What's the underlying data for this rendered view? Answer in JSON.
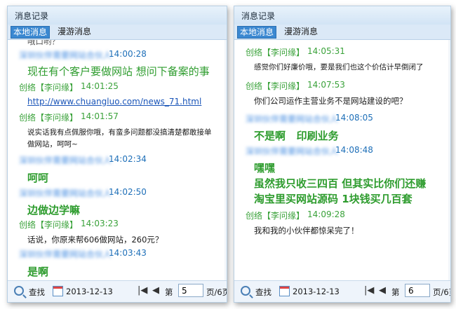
{
  "left": {
    "title": "消息记录",
    "tabs": [
      "本地消息",
      "漫游消息"
    ],
    "partial_top": "哦口哟？",
    "messages": [
      {
        "name": "深圳伙伴需要网站合伙人",
        "time": "14:00:28",
        "text": "现在有个客户要做网站 想问下备案的事",
        "style": "big"
      },
      {
        "name": "创络【李问缘】",
        "time": "14:01:25",
        "text": "http://www.chuangluo.com/news_71.html",
        "style": "link"
      },
      {
        "name": "创络【李问缘】",
        "time": "14:01:57",
        "text": "说实话我有点佩服你哦，有蛮多问题都没搞清楚都敢接单",
        "text2": "做网站，呵呵~",
        "style": "normal"
      },
      {
        "name": "深圳伙伴需要网站合伙人",
        "time": "14:02:34",
        "text": "呵呵",
        "style": "big"
      },
      {
        "name": "深圳伙伴需要网站合伙人",
        "time": "14:02:50",
        "text": "边做边学嘛",
        "style": "big"
      },
      {
        "name": "创络【李问缘】",
        "time": "14:03:23",
        "text": "话说，你原来帮606做网站，260元？",
        "style": "normal"
      },
      {
        "name": "深圳伙伴需要网站合伙人",
        "time": "14:03:43",
        "text": "是啊",
        "style": "big"
      }
    ],
    "footer": {
      "search": "查找",
      "date": "2013-12-13",
      "page_label": "第",
      "page": "5",
      "page_suffix": "页/6页"
    }
  },
  "right": {
    "title": "消息记录",
    "tabs": [
      "本地消息",
      "漫游消息"
    ],
    "messages": [
      {
        "name": "创络【李问缘】",
        "time": "14:05:31",
        "text": "感觉你们好廉价哦，要是我们也这个价估计早倒闭了",
        "style": "normal"
      },
      {
        "name": "创络【李问缘】",
        "time": "14:07:53",
        "text": "你们公司运作主营业务不是网站建设的吧？",
        "style": "normal"
      },
      {
        "name": "深圳伙伴需要网站合伙人",
        "time": "14:08:05",
        "text": "不是啊   印刷业务",
        "style": "big"
      },
      {
        "name": "深圳伙伴需要网站合伙人",
        "time": "14:08:48",
        "lines": [
          "嘿嘿",
          "虽然我只收三四百 但其实比你们还赚",
          "淘宝里买网站源码 1块钱买几百套"
        ],
        "style": "big"
      },
      {
        "name": "创络【李问缘】",
        "time": "14:09:28",
        "text": "我和我的小伙伴都惊呆完了！",
        "style": "normal"
      }
    ],
    "footer": {
      "search": "查找",
      "date": "2013-12-13",
      "page_label": "第",
      "page": "6",
      "page_suffix": "页/6页"
    }
  },
  "icons": {
    "search": "search-icon",
    "calendar": "calendar-icon",
    "first": "first-page-icon",
    "prev": "prev-page-icon"
  },
  "colors": {
    "accent": "#3b88d1",
    "me": "#3aa23a",
    "them": "#1e6fb8"
  }
}
